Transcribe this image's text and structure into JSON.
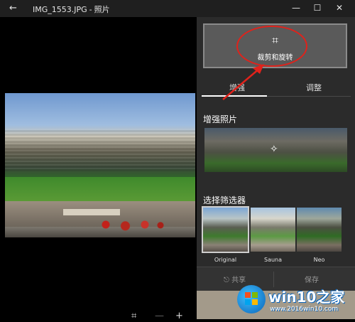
{
  "titlebar": {
    "back_icon": "←",
    "filename": "IMG_1553.JPG",
    "separator": "-",
    "app_name": "照片",
    "minimize_icon": "—",
    "maximize_icon": "☐",
    "close_icon": "✕"
  },
  "viewer": {
    "fit_icon": "⌗",
    "zoom_out_icon": "—",
    "zoom_in_icon": "+"
  },
  "panel": {
    "crop_rotate_icon": "⌗",
    "crop_rotate_label": "裁剪和旋转",
    "tabs": [
      {
        "label": "增强",
        "selected": true
      },
      {
        "label": "调整",
        "selected": false
      }
    ],
    "enhance_title": "增强照片",
    "enhance_wand_icon": "✧",
    "filter_title": "选择筛选器",
    "filters": [
      {
        "label": "Original",
        "selected": true
      },
      {
        "label": "Sauna",
        "selected": false
      },
      {
        "label": "Neo",
        "selected": false
      }
    ],
    "share_label": "共享",
    "share_icon": "⎋",
    "save_label": "保存"
  },
  "watermark": {
    "title": "win10之家",
    "url": "www.2016win10.com"
  },
  "colors": {
    "titlebar_bg": "#1f1f1f",
    "panel_bg": "#2b2b2b",
    "button_bg": "#5a5a5a",
    "annotation_red": "#e0221b"
  }
}
